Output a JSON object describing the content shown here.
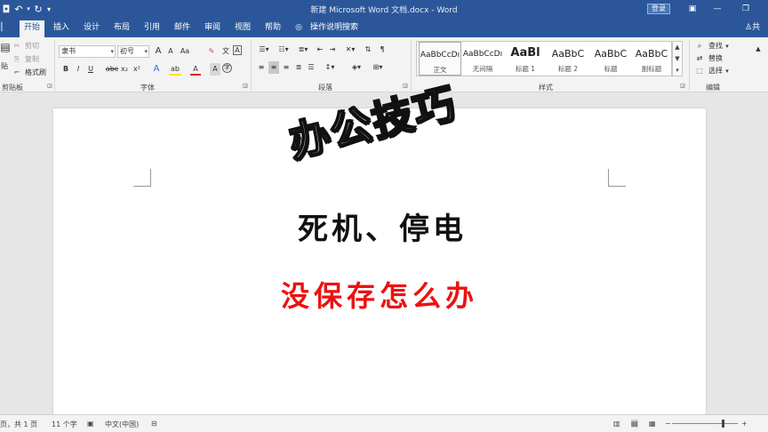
{
  "app": {
    "title": "新建 Microsoft Word 文档.docx  -  Word",
    "signin": "登录",
    "share": "共"
  },
  "tabs": [
    "开始",
    "插入",
    "设计",
    "布局",
    "引用",
    "邮件",
    "审阅",
    "视图",
    "帮助"
  ],
  "tell_me": "操作说明搜索",
  "ribbon": {
    "clipboard": {
      "label": "剪贴板",
      "paste": "贴",
      "cut": "剪切",
      "copy": "复制",
      "format_painter": "格式刷"
    },
    "font": {
      "label": "字体",
      "font_name": "隶书",
      "font_size": "初号",
      "bold": "B",
      "italic": "I",
      "underline": "U",
      "strike": "abc",
      "subscript": "x₂",
      "superscript": "x²",
      "grow": "A",
      "shrink": "A",
      "case": "Aa",
      "text_effect": "A",
      "highlight": "ab",
      "font_color": "A",
      "char_border": "A",
      "enclose": "字",
      "phonetic": "文"
    },
    "paragraph": {
      "label": "段落"
    },
    "styles": {
      "label": "样式",
      "items": [
        {
          "sample": "AaBbCcDı",
          "name": "正文"
        },
        {
          "sample": "AaBbCcDı",
          "name": "无间隔"
        },
        {
          "sample": "AaBl",
          "name": "标题 1"
        },
        {
          "sample": "AaBbC",
          "name": "标题 2"
        },
        {
          "sample": "AaBbC",
          "name": "标题"
        },
        {
          "sample": "AaBbC",
          "name": "副标题"
        }
      ]
    },
    "editing": {
      "label": "编辑",
      "find": "查找",
      "replace": "替换",
      "select": "选择"
    }
  },
  "document": {
    "watermark": "办公技巧",
    "line1": "死机、停电",
    "line2": "没保存怎么办"
  },
  "status": {
    "page": "页，共 1 页",
    "words": "11 个字",
    "language": "中文(中国)"
  },
  "colors": {
    "accent": "#2b579a",
    "red_text": "#ee1111"
  }
}
